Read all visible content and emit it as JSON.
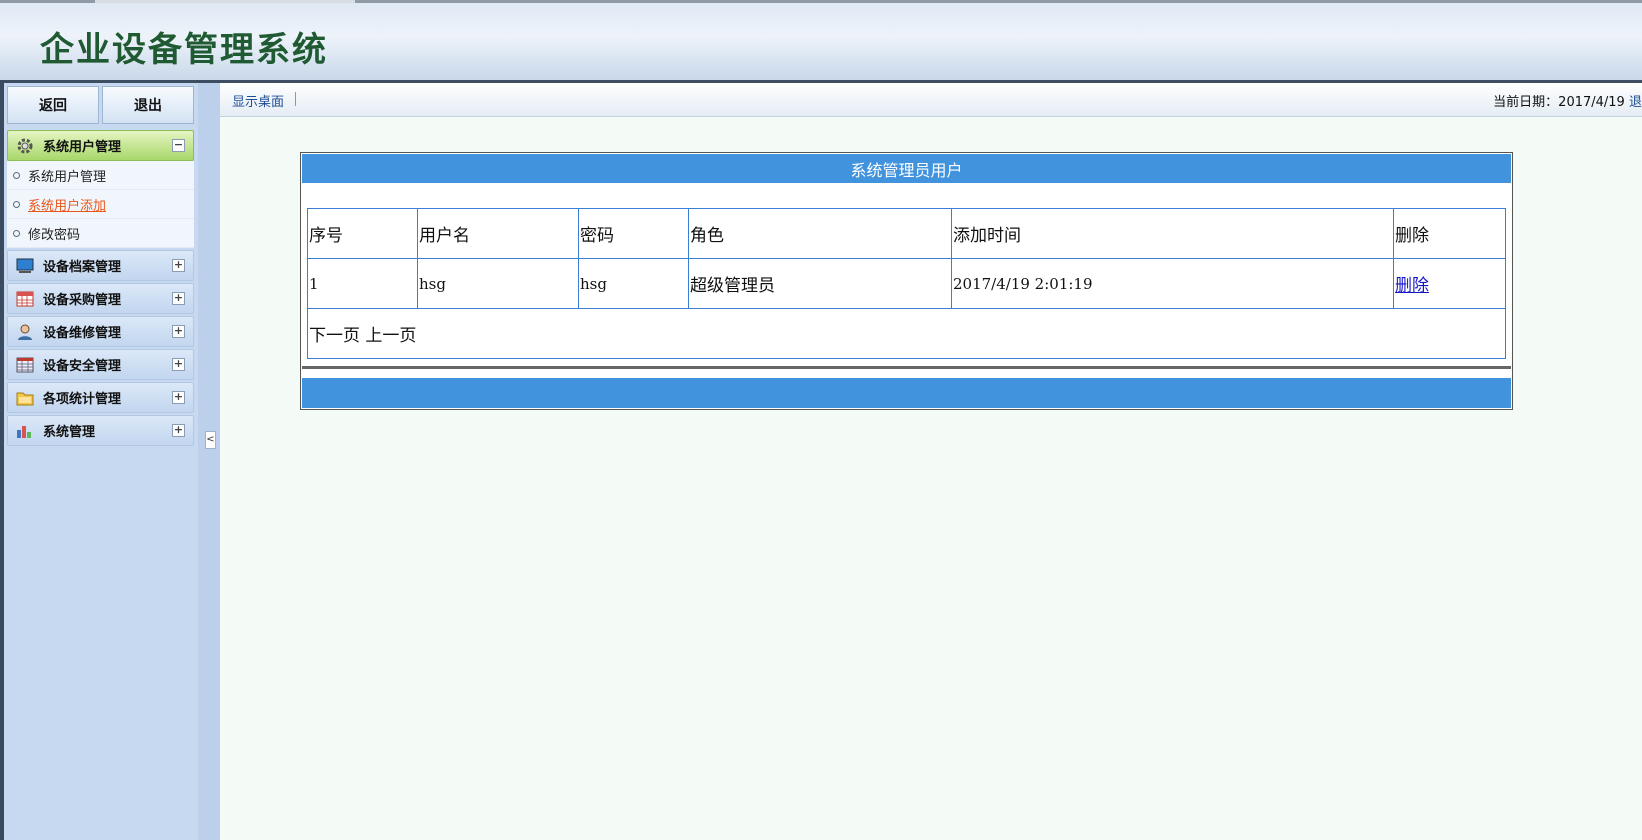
{
  "header": {
    "title": "企业设备管理系统"
  },
  "sidebar": {
    "back_label": "返回",
    "exit_label": "退出",
    "groups": [
      {
        "label": "系统用户管理",
        "icon": "gear-icon",
        "expanded": true,
        "toggle": "−",
        "items": [
          {
            "label": "系统用户管理"
          },
          {
            "label": "系统用户添加",
            "current": true
          },
          {
            "label": "修改密码"
          }
        ]
      },
      {
        "label": "设备档案管理",
        "icon": "monitor-icon",
        "toggle": "+"
      },
      {
        "label": "设备采购管理",
        "icon": "calendar-icon",
        "toggle": "+"
      },
      {
        "label": "设备维修管理",
        "icon": "person-icon",
        "toggle": "+"
      },
      {
        "label": "设备安全管理",
        "icon": "spreadsheet-icon",
        "toggle": "+"
      },
      {
        "label": "各项统计管理",
        "icon": "folder-icon",
        "toggle": "+"
      },
      {
        "label": "系统管理",
        "icon": "bar-chart-icon",
        "toggle": "+"
      }
    ],
    "collapse_glyph": "<"
  },
  "topbar": {
    "desktop_link": "显示桌面",
    "date_label": "当前日期：",
    "date_value": "2017/4/19",
    "logout_partial": "退"
  },
  "panel": {
    "title": "系统管理员用户",
    "columns": [
      "序号",
      "用户名",
      "密码",
      "角色",
      "添加时间",
      "删除"
    ],
    "rows": [
      {
        "id": "1",
        "username": "hsg",
        "password": "hsg",
        "role": "超级管理员",
        "added": "2017/4/19 2:01:19",
        "delete": "删除"
      }
    ],
    "next_page": "下一页",
    "prev_page": "上一页"
  },
  "colors": {
    "accent_blue": "#4193dd",
    "sidebar_bg": "#c6d9f1",
    "active_green": "#a8d86a",
    "title_green": "#1f5a32",
    "link_orange": "#e8581a"
  }
}
